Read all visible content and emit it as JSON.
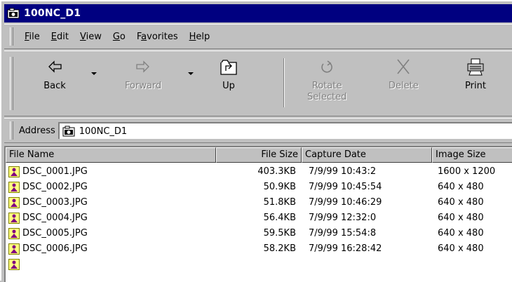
{
  "window": {
    "title": "100NC_D1",
    "icon": "camera-folder-icon"
  },
  "menu": [
    {
      "pre": "",
      "accel": "F",
      "post": "ile"
    },
    {
      "pre": "",
      "accel": "E",
      "post": "dit"
    },
    {
      "pre": "",
      "accel": "V",
      "post": "iew"
    },
    {
      "pre": "",
      "accel": "G",
      "post": "o"
    },
    {
      "pre": "F",
      "accel": "a",
      "post": "vorites"
    },
    {
      "pre": "",
      "accel": "H",
      "post": "elp"
    }
  ],
  "toolbar": {
    "back": "Back",
    "forward": "Forward",
    "up": "Up",
    "rotate_line1": "Rotate",
    "rotate_line2": "Selected",
    "delete": "Delete",
    "print": "Print"
  },
  "address": {
    "label": "Address",
    "value": "100NC_D1"
  },
  "columns": {
    "name": "File Name",
    "size": "File Size",
    "date": "Capture Date",
    "image": "Image Size"
  },
  "files": [
    {
      "name": "DSC_0001.JPG",
      "size": "403.3KB",
      "date": "7/9/99 10:43:2",
      "image": "1600 x 1200"
    },
    {
      "name": "DSC_0002.JPG",
      "size": "50.9KB",
      "date": "7/9/99 10:45:54",
      "image": "640 x 480"
    },
    {
      "name": "DSC_0003.JPG",
      "size": "51.8KB",
      "date": "7/9/99 10:46:29",
      "image": "640 x 480"
    },
    {
      "name": "DSC_0004.JPG",
      "size": "56.4KB",
      "date": "7/9/99 12:32:0",
      "image": "640 x 480"
    },
    {
      "name": "DSC_0005.JPG",
      "size": "59.5KB",
      "date": "7/9/99 15:54:8",
      "image": "640 x 480"
    },
    {
      "name": "DSC_0006.JPG",
      "size": "58.2KB",
      "date": "7/9/99 16:28:42",
      "image": "640 x 480"
    }
  ]
}
